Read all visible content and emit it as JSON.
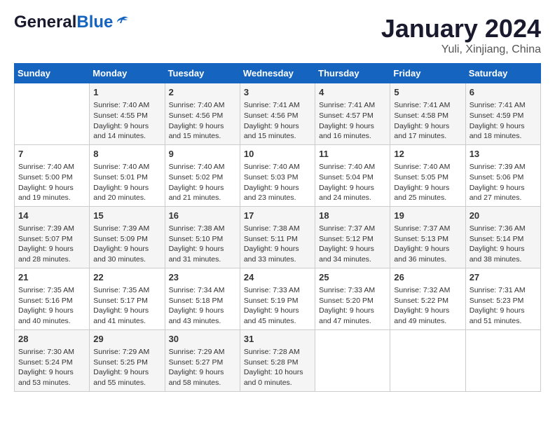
{
  "header": {
    "logo_general": "General",
    "logo_blue": "Blue",
    "month_title": "January 2024",
    "location": "Yuli, Xinjiang, China"
  },
  "weekdays": [
    "Sunday",
    "Monday",
    "Tuesday",
    "Wednesday",
    "Thursday",
    "Friday",
    "Saturday"
  ],
  "weeks": [
    [
      {
        "day": "",
        "info": ""
      },
      {
        "day": "1",
        "info": "Sunrise: 7:40 AM\nSunset: 4:55 PM\nDaylight: 9 hours\nand 14 minutes."
      },
      {
        "day": "2",
        "info": "Sunrise: 7:40 AM\nSunset: 4:56 PM\nDaylight: 9 hours\nand 15 minutes."
      },
      {
        "day": "3",
        "info": "Sunrise: 7:41 AM\nSunset: 4:56 PM\nDaylight: 9 hours\nand 15 minutes."
      },
      {
        "day": "4",
        "info": "Sunrise: 7:41 AM\nSunset: 4:57 PM\nDaylight: 9 hours\nand 16 minutes."
      },
      {
        "day": "5",
        "info": "Sunrise: 7:41 AM\nSunset: 4:58 PM\nDaylight: 9 hours\nand 17 minutes."
      },
      {
        "day": "6",
        "info": "Sunrise: 7:41 AM\nSunset: 4:59 PM\nDaylight: 9 hours\nand 18 minutes."
      }
    ],
    [
      {
        "day": "7",
        "info": "Sunrise: 7:40 AM\nSunset: 5:00 PM\nDaylight: 9 hours\nand 19 minutes."
      },
      {
        "day": "8",
        "info": "Sunrise: 7:40 AM\nSunset: 5:01 PM\nDaylight: 9 hours\nand 20 minutes."
      },
      {
        "day": "9",
        "info": "Sunrise: 7:40 AM\nSunset: 5:02 PM\nDaylight: 9 hours\nand 21 minutes."
      },
      {
        "day": "10",
        "info": "Sunrise: 7:40 AM\nSunset: 5:03 PM\nDaylight: 9 hours\nand 23 minutes."
      },
      {
        "day": "11",
        "info": "Sunrise: 7:40 AM\nSunset: 5:04 PM\nDaylight: 9 hours\nand 24 minutes."
      },
      {
        "day": "12",
        "info": "Sunrise: 7:40 AM\nSunset: 5:05 PM\nDaylight: 9 hours\nand 25 minutes."
      },
      {
        "day": "13",
        "info": "Sunrise: 7:39 AM\nSunset: 5:06 PM\nDaylight: 9 hours\nand 27 minutes."
      }
    ],
    [
      {
        "day": "14",
        "info": "Sunrise: 7:39 AM\nSunset: 5:07 PM\nDaylight: 9 hours\nand 28 minutes."
      },
      {
        "day": "15",
        "info": "Sunrise: 7:39 AM\nSunset: 5:09 PM\nDaylight: 9 hours\nand 30 minutes."
      },
      {
        "day": "16",
        "info": "Sunrise: 7:38 AM\nSunset: 5:10 PM\nDaylight: 9 hours\nand 31 minutes."
      },
      {
        "day": "17",
        "info": "Sunrise: 7:38 AM\nSunset: 5:11 PM\nDaylight: 9 hours\nand 33 minutes."
      },
      {
        "day": "18",
        "info": "Sunrise: 7:37 AM\nSunset: 5:12 PM\nDaylight: 9 hours\nand 34 minutes."
      },
      {
        "day": "19",
        "info": "Sunrise: 7:37 AM\nSunset: 5:13 PM\nDaylight: 9 hours\nand 36 minutes."
      },
      {
        "day": "20",
        "info": "Sunrise: 7:36 AM\nSunset: 5:14 PM\nDaylight: 9 hours\nand 38 minutes."
      }
    ],
    [
      {
        "day": "21",
        "info": "Sunrise: 7:35 AM\nSunset: 5:16 PM\nDaylight: 9 hours\nand 40 minutes."
      },
      {
        "day": "22",
        "info": "Sunrise: 7:35 AM\nSunset: 5:17 PM\nDaylight: 9 hours\nand 41 minutes."
      },
      {
        "day": "23",
        "info": "Sunrise: 7:34 AM\nSunset: 5:18 PM\nDaylight: 9 hours\nand 43 minutes."
      },
      {
        "day": "24",
        "info": "Sunrise: 7:33 AM\nSunset: 5:19 PM\nDaylight: 9 hours\nand 45 minutes."
      },
      {
        "day": "25",
        "info": "Sunrise: 7:33 AM\nSunset: 5:20 PM\nDaylight: 9 hours\nand 47 minutes."
      },
      {
        "day": "26",
        "info": "Sunrise: 7:32 AM\nSunset: 5:22 PM\nDaylight: 9 hours\nand 49 minutes."
      },
      {
        "day": "27",
        "info": "Sunrise: 7:31 AM\nSunset: 5:23 PM\nDaylight: 9 hours\nand 51 minutes."
      }
    ],
    [
      {
        "day": "28",
        "info": "Sunrise: 7:30 AM\nSunset: 5:24 PM\nDaylight: 9 hours\nand 53 minutes."
      },
      {
        "day": "29",
        "info": "Sunrise: 7:29 AM\nSunset: 5:25 PM\nDaylight: 9 hours\nand 55 minutes."
      },
      {
        "day": "30",
        "info": "Sunrise: 7:29 AM\nSunset: 5:27 PM\nDaylight: 9 hours\nand 58 minutes."
      },
      {
        "day": "31",
        "info": "Sunrise: 7:28 AM\nSunset: 5:28 PM\nDaylight: 10 hours\nand 0 minutes."
      },
      {
        "day": "",
        "info": ""
      },
      {
        "day": "",
        "info": ""
      },
      {
        "day": "",
        "info": ""
      }
    ]
  ]
}
